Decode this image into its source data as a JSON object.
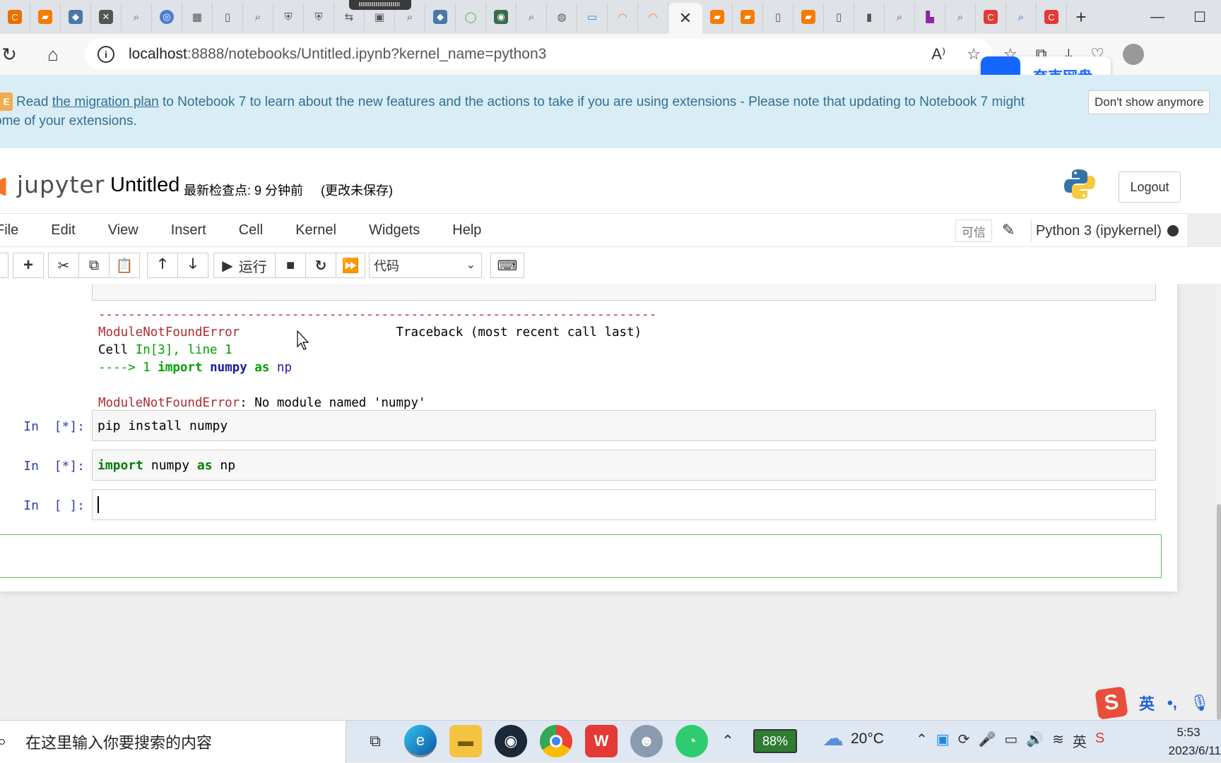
{
  "browser": {
    "tabs": {
      "active_close": "✕",
      "new_tab": "+"
    },
    "window_controls": {
      "minimize": "—",
      "maximize": "☐"
    },
    "url": {
      "host": "localhost",
      "rest": ":8888/notebooks/Untitled.ipynb?kernel_name=python3"
    },
    "quark_pan": {
      "label": "夸克网盘"
    }
  },
  "banner": {
    "badge": "E",
    "text_before": "Read ",
    "link": "the migration plan",
    "text_after": " to Notebook 7 to learn about the new features and the actions to take if you are using extensions - Please note that updating to Notebook 7 might",
    "line2": "ome of your extensions.",
    "dismiss": "Don't show anymore"
  },
  "header": {
    "logo_text": "jupyter",
    "notebook_name": "Untitled",
    "checkpoint": "最新检查点: 9 分钟前",
    "unsaved": "(更改未保存)",
    "logout": "Logout"
  },
  "menubar": {
    "items": [
      "File",
      "Edit",
      "View",
      "Insert",
      "Cell",
      "Kernel",
      "Widgets",
      "Help"
    ],
    "trusted": "可信",
    "kernel_name": "Python 3 (ipykernel)"
  },
  "toolbar": {
    "run_label": "运行",
    "cell_type": "代码"
  },
  "output": {
    "dashes": "---------------------------------------------------------------------------",
    "error_name": "ModuleNotFoundError",
    "traceback_label": "Traceback (most recent call last)",
    "cell_ref_prefix": "Cell ",
    "cell_ref_in": "In[3], line 1",
    "arrow": "----> 1 ",
    "arrow_import": "import",
    "arrow_module": "numpy",
    "arrow_as": "as",
    "arrow_alias": "np",
    "error_name2": "ModuleNotFoundError",
    "error_msg": ": No module named 'numpy'"
  },
  "cells": [
    {
      "prompt": "In  [*]:",
      "code": "pip install numpy"
    },
    {
      "prompt": "In  [*]:",
      "kw1": "import",
      "mid": " numpy ",
      "kw2": "as",
      "end": " np"
    },
    {
      "prompt": "In  [ ]:",
      "code": ""
    }
  ],
  "taskbar": {
    "search_placeholder": "在这里输入你要搜索的内容",
    "battery": "88%",
    "temperature": "20°C",
    "time": "5:53",
    "date": "2023/6/11"
  },
  "ime": {
    "lang": "英"
  }
}
